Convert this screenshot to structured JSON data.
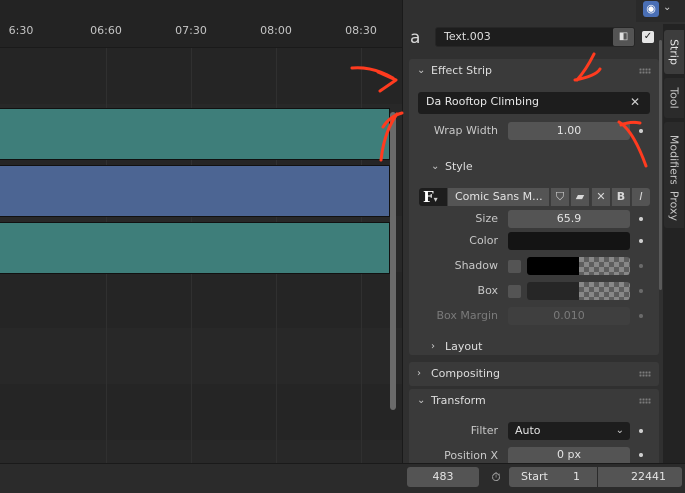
{
  "timeline": {
    "ticks": [
      "6:30",
      "06:60",
      "07:30",
      "08:00",
      "08:30"
    ]
  },
  "header": {
    "strip_name": "Text.003",
    "strip_icon": "a"
  },
  "effect_strip": {
    "title": "Effect Strip",
    "text": "Da Rooftop Climbing",
    "wrap_width_label": "Wrap Width",
    "wrap_width_value": "1.00"
  },
  "style": {
    "title": "Style",
    "font_name": "Comic Sans M...",
    "size_label": "Size",
    "size_value": "65.9",
    "color_label": "Color",
    "shadow_label": "Shadow",
    "box_label": "Box",
    "box_margin_label": "Box Margin",
    "box_margin_value": "0.010",
    "layout_label": "Layout"
  },
  "compositing": {
    "title": "Compositing"
  },
  "transform": {
    "title": "Transform",
    "filter_label": "Filter",
    "filter_value": "Auto",
    "position_x_label": "Position X",
    "position_x_value": "0 px"
  },
  "side_tabs": [
    "Strip",
    "Tool",
    "Modifiers",
    "Proxy"
  ],
  "footer": {
    "current_frame": "483",
    "start_label": "Start",
    "start_value": "1",
    "end_value": "22441"
  },
  "colors": {
    "teal_strip": "#3e7e7a",
    "blue_strip": "#4c6593",
    "annotation": "#ff3b1f"
  }
}
